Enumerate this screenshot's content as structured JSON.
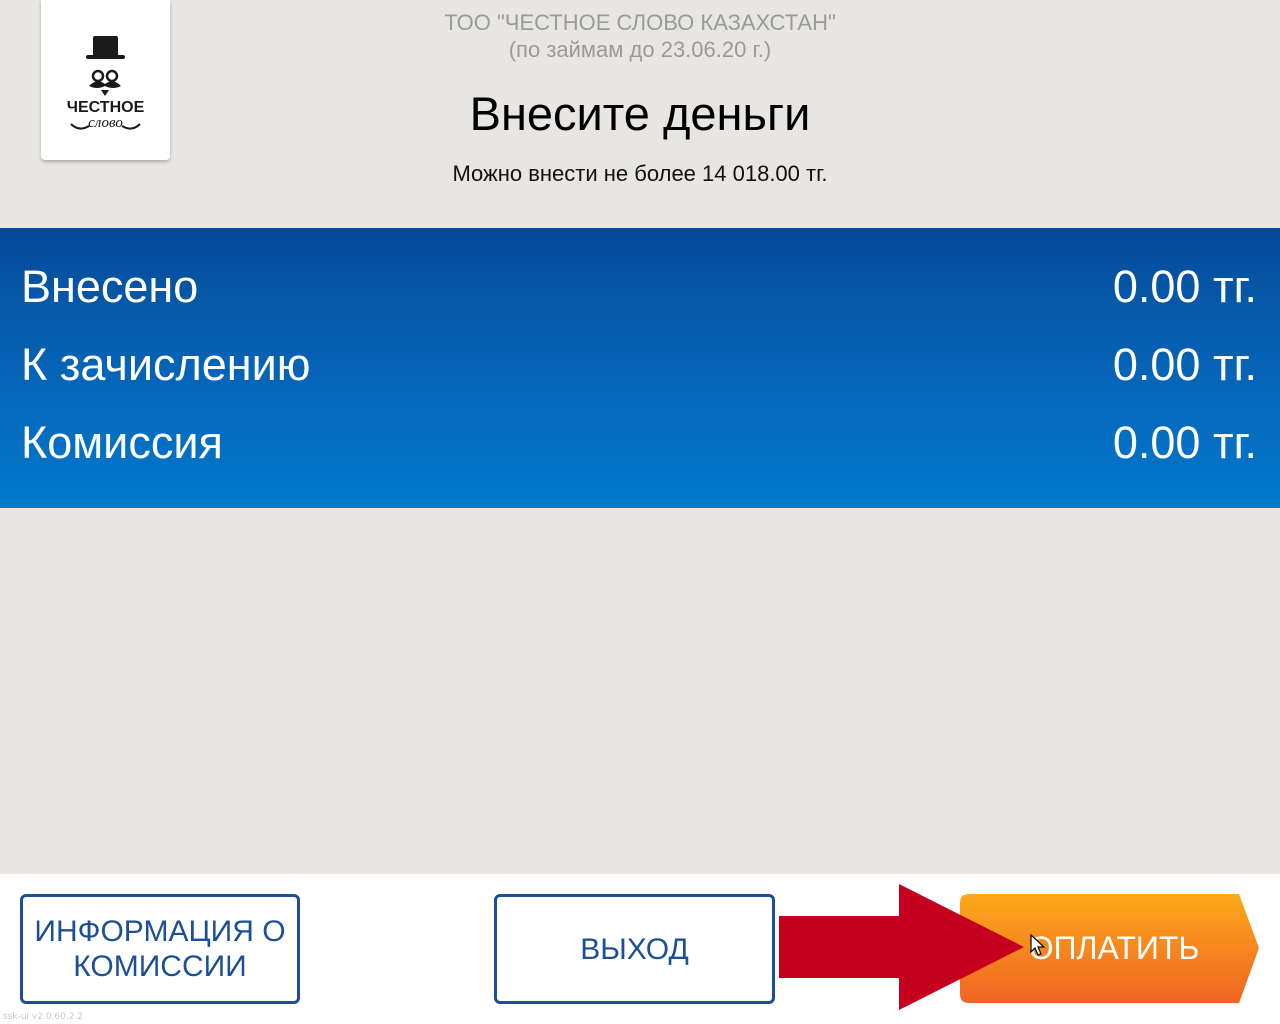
{
  "logo": {
    "text_line1": "ЧЕСТНОЕ",
    "text_line2": "слово"
  },
  "header": {
    "org_name": "ТОО \"ЧЕСТНОЕ СЛОВО КАЗАХСТАН\"",
    "org_note": "(по займам до 23.06.20 г.)",
    "title": "Внесите деньги",
    "limit_note": "Можно внести не более 14 018.00 тг."
  },
  "summary": {
    "rows": [
      {
        "label": "Внесено",
        "value": "0.00 тг."
      },
      {
        "label": "К зачислению",
        "value": "0.00 тг."
      },
      {
        "label": "Комиссия",
        "value": "0.00 тг."
      }
    ]
  },
  "footer": {
    "info_button_line1": "ИНФОРМАЦИЯ О",
    "info_button_line2": "КОМИССИИ",
    "exit_button": "ВЫХОД",
    "pay_button": "ОПЛАТИТЬ"
  },
  "version": "ssk-ui v2.0.60.2.2",
  "colors": {
    "background": "#e8e6e3",
    "panel_top": "#064a98",
    "panel_bottom": "#0279cd",
    "outline_button": "#1d4f94",
    "pay_top": "#fcaa1a",
    "pay_bottom": "#f06423",
    "arrow": "#c4001e"
  }
}
